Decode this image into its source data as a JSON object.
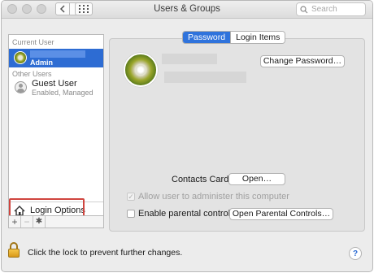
{
  "window": {
    "title": "Users & Groups",
    "search_placeholder": "Search"
  },
  "toolbar": {
    "back_icon": "chevron-left-icon",
    "forward_icon": "chevron-right-icon",
    "show_all_icon": "grid-icon"
  },
  "sidebar": {
    "current_user_header": "Current User",
    "current_user_role": "Admin",
    "other_users_header": "Other Users",
    "guest_name": "Guest User",
    "guest_status": "Enabled, Managed",
    "login_options_label": "Login Options",
    "add_symbol": "+",
    "remove_symbol": "−",
    "gear_symbol": "✱"
  },
  "tabs": [
    {
      "label": "Password",
      "active": true
    },
    {
      "label": "Login Items",
      "active": false
    }
  ],
  "main": {
    "change_password_label": "Change Password…",
    "contacts_card_label": "Contacts Card:",
    "open_label": "Open…",
    "allow_admin_label": "Allow user to administer this computer",
    "allow_admin_checked": true,
    "allow_admin_enabled": false,
    "parental_controls_label": "Enable parental controls",
    "parental_controls_checked": false,
    "open_parental_label": "Open Parental Controls…"
  },
  "footer": {
    "lock_text": "Click the lock to prevent further changes.",
    "help_symbol": "?"
  },
  "colors": {
    "accent": "#2f73dc",
    "selection": "#2d6cd3",
    "annotation": "#d0453f"
  }
}
